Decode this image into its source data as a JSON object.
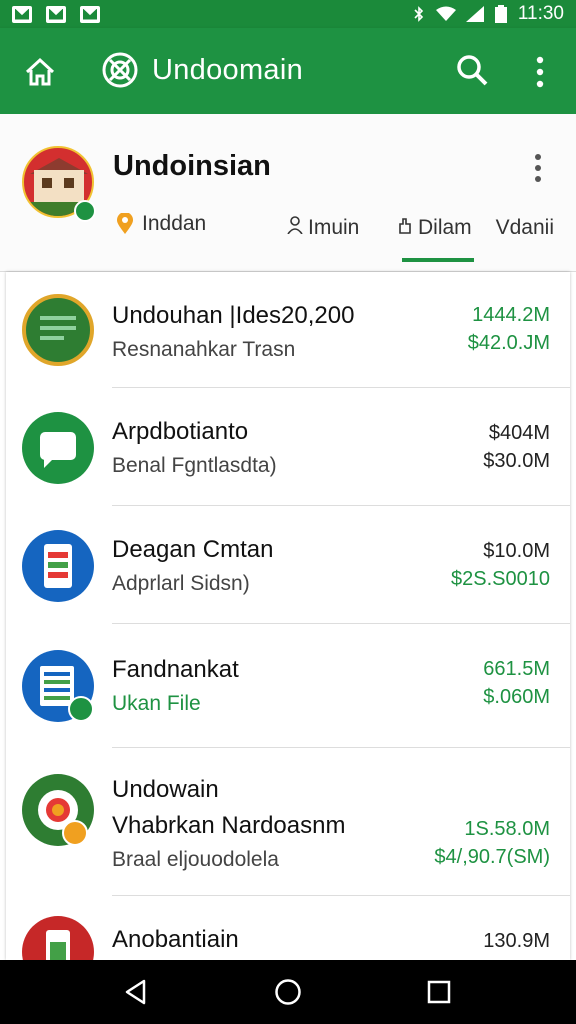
{
  "status_bar": {
    "time": "11:30",
    "notifications": [
      "gmail-icon",
      "image-icon",
      "mail-icon"
    ],
    "system_icons": [
      "bluetooth-icon",
      "wifi-icon",
      "signal-icon",
      "battery-icon"
    ]
  },
  "app_bar": {
    "title": "Undoomain",
    "icons": [
      "home-icon",
      "app-logo-icon",
      "search-icon",
      "more-vert-icon"
    ]
  },
  "header": {
    "title": "Undoinsian",
    "location": "Inddan",
    "tabs": [
      {
        "label": "Imuin",
        "icon": "person-icon"
      },
      {
        "label": "Dilam",
        "icon": "hand-icon",
        "selected": true
      },
      {
        "label": "Vdanii"
      }
    ]
  },
  "items": [
    {
      "title": "Undouhan |Ides20,200",
      "subtitle": "Resnanahkar Trasn",
      "amount_top": "1444.2M",
      "amount_bottom": "$42.0.JM",
      "icon": "notes-icon",
      "color": "#2e7d32"
    },
    {
      "title": "Arpdbotianto",
      "subtitle": "Benal Fgntlasdta)",
      "amount_top": "$404M",
      "amount_bottom": "$30.0M",
      "icon": "chat-icon",
      "color": "#1e9242"
    },
    {
      "title": "Deagan Cmtan",
      "subtitle": "Adprlarl Sidsn)",
      "amount_top": "$10.0M",
      "amount_bottom": "$2S.S0010",
      "icon": "phone-icon",
      "color": "#1565c0"
    },
    {
      "title": "Fandnankat",
      "subtitle": "Ukan File",
      "amount_top": "661.5M",
      "amount_bottom": "$.060M",
      "icon": "sheet-icon",
      "color": "#1565c0"
    },
    {
      "title": "Undowain",
      "title2": "Vhabrkan Nardoasnm",
      "subtitle": "Braal eljouodolela",
      "amount_top": "1S.58.0M",
      "amount_bottom": "$4/,90.7(SM)",
      "icon": "target-icon",
      "color": "#2e7d32"
    },
    {
      "title": "Anobantiain",
      "amount_top": "130.9M",
      "icon": "battery-icon",
      "color": "#c62828"
    }
  ],
  "nav": [
    "back-icon",
    "home-circle-icon",
    "recents-icon"
  ]
}
